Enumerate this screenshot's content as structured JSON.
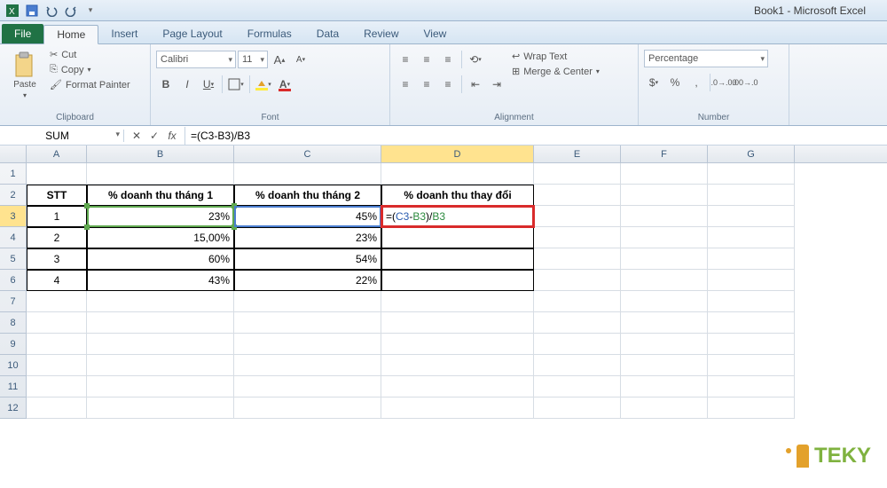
{
  "title": "Book1 - Microsoft Excel",
  "tabs": {
    "file": "File",
    "home": "Home",
    "insert": "Insert",
    "pagelayout": "Page Layout",
    "formulas": "Formulas",
    "data": "Data",
    "review": "Review",
    "view": "View"
  },
  "clipboard": {
    "paste": "Paste",
    "cut": "Cut",
    "copy": "Copy ",
    "painter": "Format Painter",
    "label": "Clipboard"
  },
  "font": {
    "name": "Calibri",
    "size": "11",
    "bold": "B",
    "italic": "I",
    "underline": "U",
    "label": "Font"
  },
  "alignment": {
    "wrap": "Wrap Text",
    "merge": "Merge & Center ",
    "label": "Alignment"
  },
  "number": {
    "format": "Percentage",
    "label": "Number"
  },
  "namebox": "SUM",
  "formula": "=(C3-B3)/B3",
  "cols": [
    "A",
    "B",
    "C",
    "D",
    "E",
    "F",
    "G"
  ],
  "rows": [
    "1",
    "2",
    "3",
    "4",
    "5",
    "6",
    "7",
    "8",
    "9",
    "10",
    "11",
    "12"
  ],
  "cells": {
    "A2": "STT",
    "B2": "% doanh thu tháng 1",
    "C2": "% doanh thu tháng 2",
    "D2": "% doanh thu thay đổi",
    "A3": "1",
    "B3": "23%",
    "C3": "45%",
    "D3_eq": "=(",
    "D3_c3": "C3",
    "D3_mid": "-",
    "D3_b3": "B3",
    "D3_mid2": ")/",
    "D3_b3b": "B3",
    "A4": "2",
    "B4": "15,00%",
    "C4": "23%",
    "A5": "3",
    "B5": "60%",
    "C5": "54%",
    "A6": "4",
    "B6": "43%",
    "C6": "22%"
  },
  "watermark": "TEKY",
  "chart_data": {
    "type": "table",
    "headers": [
      "STT",
      "% doanh thu tháng 1",
      "% doanh thu tháng 2",
      "% doanh thu thay đổi"
    ],
    "rows": [
      [
        1,
        0.23,
        0.45,
        "=(C3-B3)/B3"
      ],
      [
        2,
        0.15,
        0.23,
        null
      ],
      [
        3,
        0.6,
        0.54,
        null
      ],
      [
        4,
        0.43,
        0.22,
        null
      ]
    ]
  }
}
